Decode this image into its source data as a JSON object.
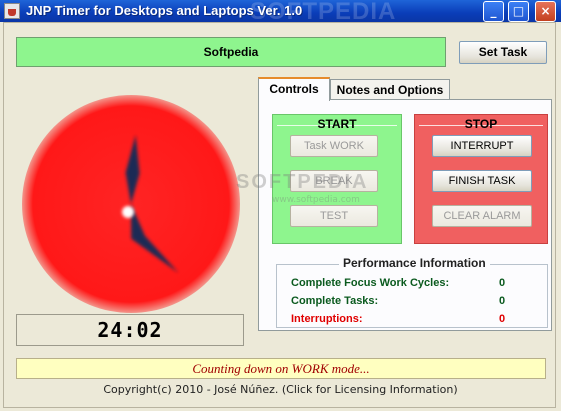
{
  "window": {
    "title": "JNP Timer for Desktops and Laptops Ver. 1.0",
    "watermark": "SOFTPEDIA",
    "minimize_symbol": "_",
    "maximize_symbol": "□",
    "close_symbol": "×"
  },
  "task": {
    "name": "Softpedia",
    "set_task_label": "Set Task",
    "banner_color": "#8ef58e"
  },
  "clock": {
    "face_color": "#ff1a1a",
    "hand_color": "#1e2a55",
    "time_display": "24:02"
  },
  "tabs": [
    {
      "label": "Controls",
      "active": true
    },
    {
      "label": "Notes and Options",
      "active": false
    }
  ],
  "start_panel": {
    "title": "START",
    "color": "#8ef58e",
    "buttons": [
      {
        "label": "Task WORK",
        "enabled": false
      },
      {
        "label": "BREAK",
        "enabled": false
      },
      {
        "label": "TEST",
        "enabled": false
      }
    ]
  },
  "stop_panel": {
    "title": "STOP",
    "color": "#f06060",
    "buttons": [
      {
        "label": "INTERRUPT",
        "enabled": true
      },
      {
        "label": "FINISH TASK",
        "enabled": true
      },
      {
        "label": "CLEAR ALARM",
        "enabled": false
      }
    ]
  },
  "performance": {
    "title": "Performance Information",
    "rows": [
      {
        "label": "Complete Focus Work Cycles:",
        "value": "0",
        "color": "#0a5a1e"
      },
      {
        "label": "Complete Tasks:",
        "value": "0",
        "color": "#0a5a1e"
      },
      {
        "label": "Interruptions:",
        "value": "0",
        "color": "#e00000"
      }
    ]
  },
  "status_text": "Counting down on WORK mode...",
  "copyright": "Copyright(c) 2010 - José Núñez. (Click for Licensing Information)",
  "watermarks": {
    "center": "SOFTPEDIA",
    "small": "www.softpedia.com"
  }
}
